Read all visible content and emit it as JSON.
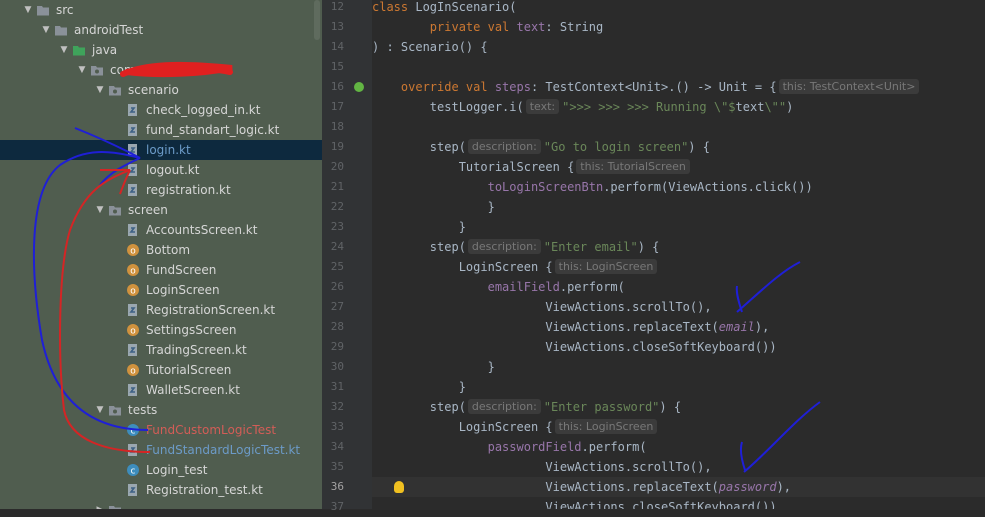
{
  "project_tree": {
    "items": [
      {
        "label": "src",
        "kind": "folder",
        "depth": 0,
        "expanded": true
      },
      {
        "label": "androidTest",
        "kind": "folder",
        "depth": 1,
        "expanded": true
      },
      {
        "label": "java",
        "kind": "source-folder",
        "depth": 2,
        "expanded": true
      },
      {
        "label": "com",
        "kind": "package",
        "depth": 3,
        "expanded": true
      },
      {
        "label": "scenario",
        "kind": "package",
        "depth": 4,
        "expanded": true
      },
      {
        "label": "check_logged_in.kt",
        "kind": "kotlin-file",
        "depth": 5
      },
      {
        "label": "fund_standart_logic.kt",
        "kind": "kotlin-file",
        "depth": 5
      },
      {
        "label": "login.kt",
        "kind": "kotlin-file",
        "depth": 5,
        "selected": true
      },
      {
        "label": "logout.kt",
        "kind": "kotlin-file",
        "depth": 5
      },
      {
        "label": "registration.kt",
        "kind": "kotlin-file",
        "depth": 5
      },
      {
        "label": "screen",
        "kind": "package",
        "depth": 4,
        "expanded": true
      },
      {
        "label": "AccountsScreen.kt",
        "kind": "kotlin-file",
        "depth": 5
      },
      {
        "label": "Bottom",
        "kind": "kotlin-object",
        "depth": 5
      },
      {
        "label": "FundScreen",
        "kind": "kotlin-object",
        "depth": 5
      },
      {
        "label": "LoginScreen",
        "kind": "kotlin-object",
        "depth": 5
      },
      {
        "label": "RegistrationScreen.kt",
        "kind": "kotlin-file",
        "depth": 5
      },
      {
        "label": "SettingsScreen",
        "kind": "kotlin-object",
        "depth": 5
      },
      {
        "label": "TradingScreen.kt",
        "kind": "kotlin-file",
        "depth": 5
      },
      {
        "label": "TutorialScreen",
        "kind": "kotlin-object",
        "depth": 5
      },
      {
        "label": "WalletScreen.kt",
        "kind": "kotlin-file",
        "depth": 5
      },
      {
        "label": "tests",
        "kind": "package",
        "depth": 4,
        "expanded": true
      },
      {
        "label": "FundCustomLogicTest",
        "kind": "kotlin-class",
        "depth": 5,
        "color": "red"
      },
      {
        "label": "FundStandardLogicTest.kt",
        "kind": "kotlin-file",
        "depth": 5,
        "color": "blue"
      },
      {
        "label": "Login_test",
        "kind": "kotlin-class",
        "depth": 5
      },
      {
        "label": "Registration_test.kt",
        "kind": "kotlin-file",
        "depth": 5
      },
      {
        "label": "",
        "kind": "package",
        "depth": 4,
        "expanded": false
      }
    ]
  },
  "editor": {
    "current_line": 36,
    "lines": [
      {
        "n": 12,
        "seg": [
          [
            "kw",
            "class "
          ],
          [
            "",
            "LogInScenario("
          ]
        ]
      },
      {
        "n": 13,
        "seg": [
          [
            "",
            "        "
          ],
          [
            "kw",
            "private val "
          ],
          [
            "fld",
            "text"
          ],
          [
            "",
            ": String"
          ]
        ]
      },
      {
        "n": 14,
        "seg": [
          [
            "",
            ") : Scenario() {"
          ]
        ]
      },
      {
        "n": 15,
        "seg": []
      },
      {
        "n": 16,
        "seg": [
          [
            "",
            "    "
          ],
          [
            "kw",
            "override val "
          ],
          [
            "fld",
            "steps"
          ],
          [
            "",
            ": TestContext<Unit>.() -> Unit = {"
          ],
          [
            "hint",
            "this: TestContext<Unit>"
          ]
        ]
      },
      {
        "n": 17,
        "seg": [
          [
            "",
            "        testLogger.i("
          ],
          [
            "hint",
            "text:"
          ],
          [
            "st",
            "\">>> >>> >>> Running \\\"$"
          ],
          [
            "",
            "text"
          ],
          [
            "st",
            "\\\"\""
          ],
          [
            "",
            ")"
          ]
        ]
      },
      {
        "n": 18,
        "seg": []
      },
      {
        "n": 19,
        "seg": [
          [
            "",
            "        step("
          ],
          [
            "hint",
            "description:"
          ],
          [
            "st",
            "\"Go to login screen\""
          ],
          [
            "",
            ") {"
          ]
        ]
      },
      {
        "n": 20,
        "seg": [
          [
            "",
            "            TutorialScreen {"
          ],
          [
            "hint",
            "this: TutorialScreen"
          ]
        ]
      },
      {
        "n": 21,
        "seg": [
          [
            "",
            "                "
          ],
          [
            "fld",
            "toLoginScreenBtn"
          ],
          [
            "",
            ".perform(ViewActions.click())"
          ]
        ]
      },
      {
        "n": 22,
        "seg": [
          [
            "",
            "                }"
          ]
        ]
      },
      {
        "n": 23,
        "seg": [
          [
            "",
            "            }"
          ]
        ]
      },
      {
        "n": 24,
        "seg": [
          [
            "",
            "        step("
          ],
          [
            "hint",
            "description:"
          ],
          [
            "st",
            "\"Enter email\""
          ],
          [
            "",
            ") {"
          ]
        ]
      },
      {
        "n": 25,
        "seg": [
          [
            "",
            "            LoginScreen {"
          ],
          [
            "hint",
            "this: LoginScreen"
          ]
        ]
      },
      {
        "n": 26,
        "seg": [
          [
            "",
            "                "
          ],
          [
            "fld",
            "emailField"
          ],
          [
            "",
            ".perform("
          ]
        ]
      },
      {
        "n": 27,
        "seg": [
          [
            "",
            "                        ViewActions.scrollTo(),"
          ]
        ]
      },
      {
        "n": 28,
        "seg": [
          [
            "",
            "                        ViewActions.replaceText("
          ],
          [
            "prm",
            "email"
          ],
          [
            "",
            "),"
          ]
        ]
      },
      {
        "n": 29,
        "seg": [
          [
            "",
            "                        ViewActions.closeSoftKeyboard())"
          ]
        ]
      },
      {
        "n": 30,
        "seg": [
          [
            "",
            "                }"
          ]
        ]
      },
      {
        "n": 31,
        "seg": [
          [
            "",
            "            }"
          ]
        ]
      },
      {
        "n": 32,
        "seg": [
          [
            "",
            "        step("
          ],
          [
            "hint",
            "description:"
          ],
          [
            "st",
            "\"Enter password\""
          ],
          [
            "",
            ") {"
          ]
        ]
      },
      {
        "n": 33,
        "seg": [
          [
            "",
            "            LoginScreen {"
          ],
          [
            "hint",
            "this: LoginScreen"
          ]
        ]
      },
      {
        "n": 34,
        "seg": [
          [
            "",
            "                "
          ],
          [
            "fld",
            "passwordField"
          ],
          [
            "",
            ".perform("
          ]
        ]
      },
      {
        "n": 35,
        "seg": [
          [
            "",
            "                        ViewActions.scrollTo(),"
          ]
        ]
      },
      {
        "n": 36,
        "seg": [
          [
            "",
            "                        ViewActions.replaceText("
          ],
          [
            "prm",
            "password"
          ],
          [
            "",
            "),"
          ]
        ]
      },
      {
        "n": 37,
        "seg": [
          [
            "",
            "                        ViewActions.closeSoftKeyboard())"
          ]
        ]
      }
    ]
  },
  "gutter_markers": {
    "override_line": 16,
    "bulb_line": 36
  },
  "colors": {
    "tree_bg": "#505d4f",
    "editor_bg": "#2b2b2b",
    "annotation_blue": "#1f1fd6",
    "annotation_red": "#d42525"
  }
}
